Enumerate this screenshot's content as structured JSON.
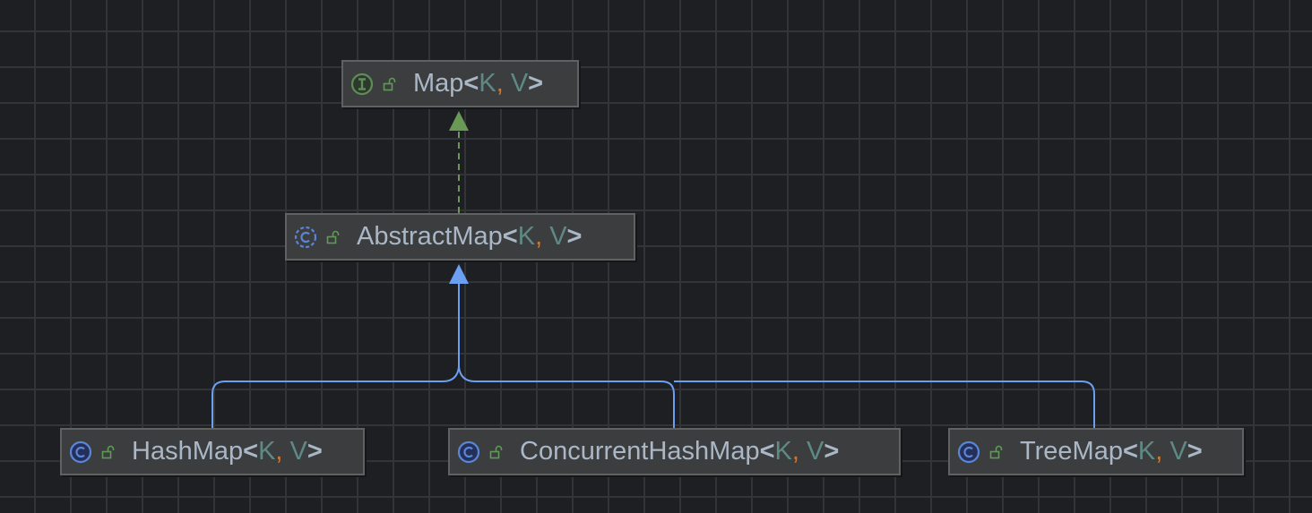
{
  "nodes": [
    {
      "id": "map",
      "kind": "interface",
      "kind_icon": "interface-icon",
      "name": "Map",
      "type_params": [
        "K",
        "V"
      ]
    },
    {
      "id": "abstractmap",
      "kind": "abstract-class",
      "kind_icon": "abstract-class-icon",
      "name": "AbstractMap",
      "type_params": [
        "K",
        "V"
      ]
    },
    {
      "id": "hashmap",
      "kind": "class",
      "kind_icon": "class-icon",
      "name": "HashMap",
      "type_params": [
        "K",
        "V"
      ]
    },
    {
      "id": "concurrenthashmap",
      "kind": "class",
      "kind_icon": "class-icon",
      "name": "ConcurrentHashMap",
      "type_params": [
        "K",
        "V"
      ]
    },
    {
      "id": "treemap",
      "kind": "class",
      "kind_icon": "class-icon",
      "name": "TreeMap",
      "type_params": [
        "K",
        "V"
      ]
    }
  ],
  "edges": [
    {
      "from": "abstractmap",
      "to": "map",
      "type": "implements",
      "style": "dashed",
      "color": "#6a9955"
    },
    {
      "from": "hashmap",
      "to": "abstractmap",
      "type": "extends",
      "style": "solid",
      "color": "#6b9ff0"
    },
    {
      "from": "concurrenthashmap",
      "to": "abstractmap",
      "type": "extends",
      "style": "solid",
      "color": "#6b9ff0"
    },
    {
      "from": "treemap",
      "to": "abstractmap",
      "type": "extends",
      "style": "solid",
      "color": "#6b9ff0"
    }
  ],
  "punctuation": {
    "open": "<",
    "comma": ",",
    "space": " ",
    "close": ">"
  },
  "colors": {
    "background": "#1e1f22",
    "node_fill": "#3c3d3f",
    "text": "#a9b7c6",
    "type_param": "#5e8a86",
    "comma": "#cc7832",
    "interface": "#5f8c58",
    "class": "#5a86d6"
  }
}
